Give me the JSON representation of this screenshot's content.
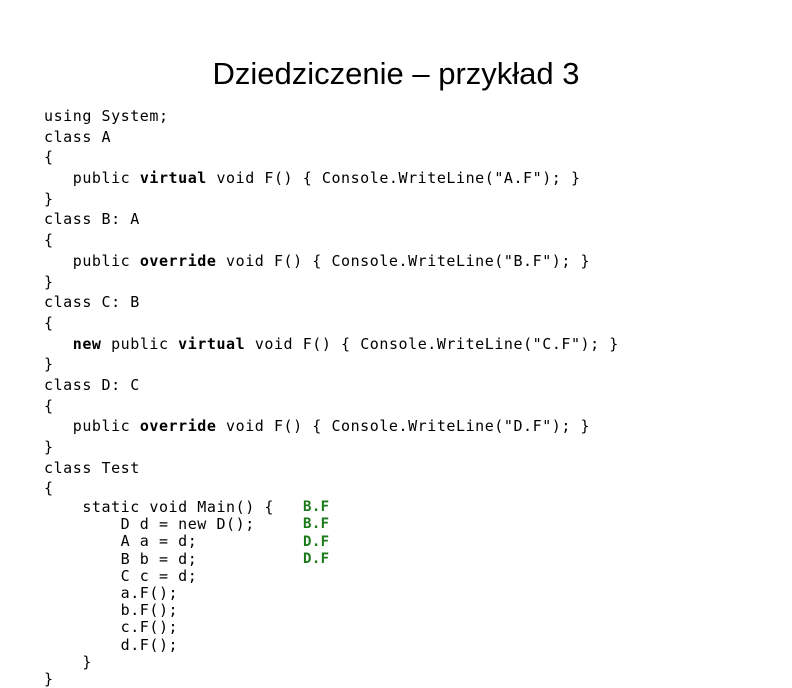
{
  "slide": {
    "title": "Dziedziczenie – przykład 3",
    "background_color": "#ffffff",
    "text_color": "#000000",
    "output_color": "#1a7a1a"
  },
  "code": {
    "language": "csharp",
    "lines": [
      {
        "id": "l01",
        "text": "using System;",
        "indent": 0,
        "tight": false,
        "segments": [
          {
            "t": "using System;",
            "bold": false
          }
        ]
      },
      {
        "id": "l02",
        "text": "class A",
        "indent": 0,
        "tight": false,
        "segments": [
          {
            "t": "class A",
            "bold": false
          }
        ]
      },
      {
        "id": "l03",
        "text": "{",
        "indent": 0,
        "tight": false,
        "segments": [
          {
            "t": "{",
            "bold": false
          }
        ]
      },
      {
        "id": "l04",
        "text": "   public virtual void F() { Console.WriteLine(\"A.F\"); }",
        "indent": 3,
        "tight": false,
        "segments": [
          {
            "t": "   public ",
            "bold": false
          },
          {
            "t": "virtual",
            "bold": true
          },
          {
            "t": " void F() { Console.WriteLine(\"A.F\"); }",
            "bold": false
          }
        ]
      },
      {
        "id": "l05",
        "text": "}",
        "indent": 0,
        "tight": false,
        "segments": [
          {
            "t": "}",
            "bold": false
          }
        ]
      },
      {
        "id": "l06",
        "text": "class B: A",
        "indent": 0,
        "tight": false,
        "segments": [
          {
            "t": "class B: A",
            "bold": false
          }
        ]
      },
      {
        "id": "l07",
        "text": "{",
        "indent": 0,
        "tight": false,
        "segments": [
          {
            "t": "{",
            "bold": false
          }
        ]
      },
      {
        "id": "l08",
        "text": "   public override void F() { Console.WriteLine(\"B.F\"); }",
        "indent": 3,
        "tight": false,
        "segments": [
          {
            "t": "   public ",
            "bold": false
          },
          {
            "t": "override",
            "bold": true
          },
          {
            "t": " void F() { Console.WriteLine(\"B.F\"); }",
            "bold": false
          }
        ]
      },
      {
        "id": "l09",
        "text": "}",
        "indent": 0,
        "tight": false,
        "segments": [
          {
            "t": "}",
            "bold": false
          }
        ]
      },
      {
        "id": "l10",
        "text": "class C: B",
        "indent": 0,
        "tight": false,
        "segments": [
          {
            "t": "class C: B",
            "bold": false
          }
        ]
      },
      {
        "id": "l11",
        "text": "{",
        "indent": 0,
        "tight": false,
        "segments": [
          {
            "t": "{",
            "bold": false
          }
        ]
      },
      {
        "id": "l12",
        "text": "   new public virtual void F() { Console.WriteLine(\"C.F\"); }",
        "indent": 3,
        "tight": false,
        "segments": [
          {
            "t": "   ",
            "bold": false
          },
          {
            "t": "new",
            "bold": true
          },
          {
            "t": " public ",
            "bold": false
          },
          {
            "t": "virtual",
            "bold": true
          },
          {
            "t": " void F() { Console.WriteLine(\"C.F\"); }",
            "bold": false
          }
        ]
      },
      {
        "id": "l13",
        "text": "}",
        "indent": 0,
        "tight": false,
        "segments": [
          {
            "t": "}",
            "bold": false
          }
        ]
      },
      {
        "id": "l14",
        "text": "class D: C",
        "indent": 0,
        "tight": false,
        "segments": [
          {
            "t": "class D: C",
            "bold": false
          }
        ]
      },
      {
        "id": "l15",
        "text": "{",
        "indent": 0,
        "tight": false,
        "segments": [
          {
            "t": "{",
            "bold": false
          }
        ]
      },
      {
        "id": "l16",
        "text": "   public override void F() { Console.WriteLine(\"D.F\"); }",
        "indent": 3,
        "tight": false,
        "segments": [
          {
            "t": "   public ",
            "bold": false
          },
          {
            "t": "override",
            "bold": true
          },
          {
            "t": " void F() { Console.WriteLine(\"D.F\"); }",
            "bold": false
          }
        ]
      },
      {
        "id": "l17",
        "text": "}",
        "indent": 0,
        "tight": false,
        "segments": [
          {
            "t": "}",
            "bold": false
          }
        ]
      },
      {
        "id": "l18",
        "text": "class Test",
        "indent": 0,
        "tight": false,
        "segments": [
          {
            "t": "class Test",
            "bold": false
          }
        ]
      },
      {
        "id": "l19",
        "text": "{",
        "indent": 0,
        "tight": false,
        "segments": [
          {
            "t": "{",
            "bold": false
          }
        ]
      },
      {
        "id": "l20",
        "text": "    static void Main() {",
        "indent": 4,
        "tight": true,
        "segments": [
          {
            "t": "    static void Main() {",
            "bold": false
          }
        ]
      },
      {
        "id": "l21",
        "text": "        D d = new D();",
        "indent": 8,
        "tight": true,
        "segments": [
          {
            "t": "        D d = new D();",
            "bold": false
          }
        ]
      },
      {
        "id": "l22",
        "text": "        A a = d;",
        "indent": 8,
        "tight": true,
        "segments": [
          {
            "t": "        A a = d;",
            "bold": false
          }
        ]
      },
      {
        "id": "l23",
        "text": "        B b = d;",
        "indent": 8,
        "tight": true,
        "segments": [
          {
            "t": "        B b = d;",
            "bold": false
          }
        ]
      },
      {
        "id": "l24",
        "text": "        C c = d;",
        "indent": 8,
        "tight": true,
        "segments": [
          {
            "t": "        C c = d;",
            "bold": false
          }
        ]
      },
      {
        "id": "l25",
        "text": "        a.F();",
        "indent": 8,
        "tight": true,
        "segments": [
          {
            "t": "        a.F();",
            "bold": false
          }
        ]
      },
      {
        "id": "l26",
        "text": "        b.F();",
        "indent": 8,
        "tight": true,
        "segments": [
          {
            "t": "        b.F();",
            "bold": false
          }
        ]
      },
      {
        "id": "l27",
        "text": "        c.F();",
        "indent": 8,
        "tight": true,
        "segments": [
          {
            "t": "        c.F();",
            "bold": false
          }
        ]
      },
      {
        "id": "l28",
        "text": "        d.F();",
        "indent": 8,
        "tight": true,
        "segments": [
          {
            "t": "        d.F();",
            "bold": false
          }
        ]
      },
      {
        "id": "l29",
        "text": "    }",
        "indent": 4,
        "tight": true,
        "segments": [
          {
            "t": "    }",
            "bold": false
          }
        ]
      },
      {
        "id": "l30",
        "text": "}",
        "indent": 0,
        "tight": true,
        "segments": [
          {
            "t": "}",
            "bold": false
          }
        ]
      }
    ]
  },
  "console_output": {
    "lines": [
      {
        "id": "o1",
        "text": "B.F"
      },
      {
        "id": "o2",
        "text": "B.F"
      },
      {
        "id": "o3",
        "text": "D.F"
      },
      {
        "id": "o4",
        "text": "D.F"
      }
    ]
  }
}
